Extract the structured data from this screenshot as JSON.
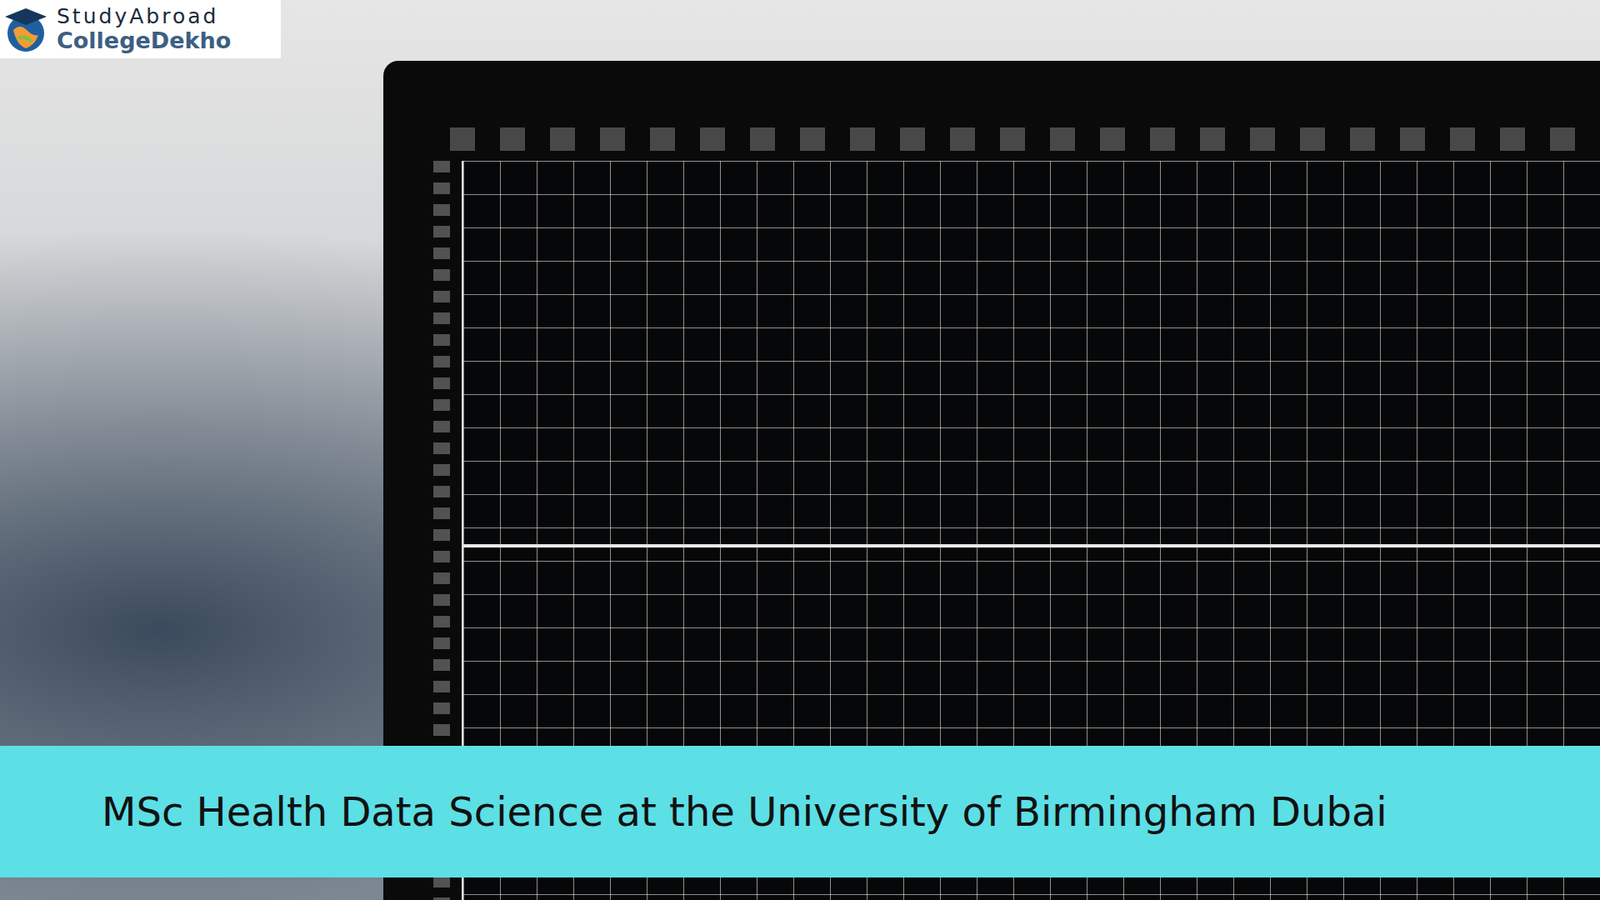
{
  "logo": {
    "line1": "StudyAbroad",
    "line2": "CollegeDekho"
  },
  "banner": {
    "title": "MSc Health Data Science at the University of Birmingham Dubai"
  }
}
